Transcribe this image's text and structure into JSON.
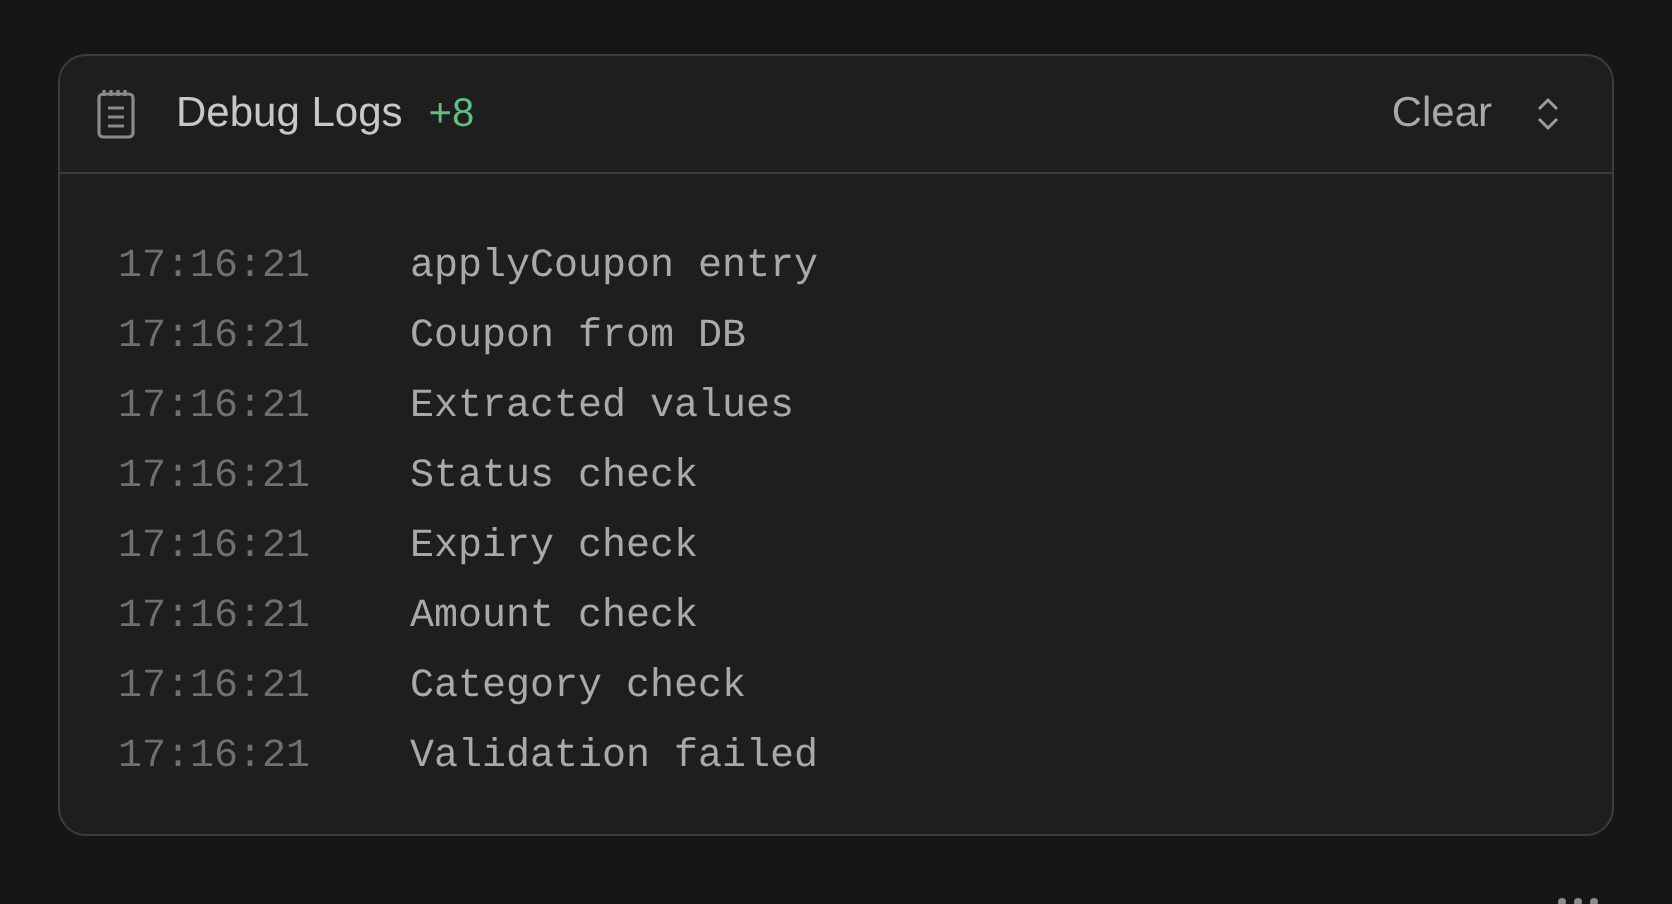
{
  "panel": {
    "title": "Debug Logs",
    "count": "+8",
    "clear_button": "Clear"
  },
  "logs": [
    {
      "time": "17:16:21",
      "message": "applyCoupon entry"
    },
    {
      "time": "17:16:21",
      "message": "Coupon from DB"
    },
    {
      "time": "17:16:21",
      "message": "Extracted values"
    },
    {
      "time": "17:16:21",
      "message": "Status check"
    },
    {
      "time": "17:16:21",
      "message": "Expiry check"
    },
    {
      "time": "17:16:21",
      "message": "Amount check"
    },
    {
      "time": "17:16:21",
      "message": "Category check"
    },
    {
      "time": "17:16:21",
      "message": "Validation failed"
    }
  ]
}
